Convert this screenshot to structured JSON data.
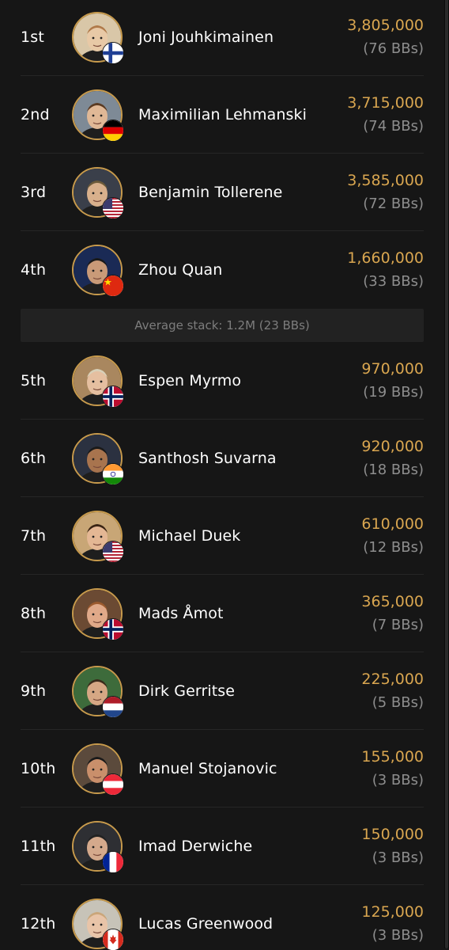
{
  "players": [
    {
      "rank": "1st",
      "name": "Joni Jouhkimainen",
      "chips": "3,805,000",
      "bbs": "(76 BBs)",
      "flag": "finland-flag-icon"
    },
    {
      "rank": "2nd",
      "name": "Maximilian Lehmanski",
      "chips": "3,715,000",
      "bbs": "(74 BBs)",
      "flag": "germany-flag-icon"
    },
    {
      "rank": "3rd",
      "name": "Benjamin Tollerene",
      "chips": "3,585,000",
      "bbs": "(72 BBs)",
      "flag": "usa-flag-icon"
    },
    {
      "rank": "4th",
      "name": "Zhou Quan",
      "chips": "1,660,000",
      "bbs": "(33 BBs)",
      "flag": "china-flag-icon"
    },
    {
      "rank": "5th",
      "name": "Espen Myrmo",
      "chips": "970,000",
      "bbs": "(19 BBs)",
      "flag": "norway-flag-icon"
    },
    {
      "rank": "6th",
      "name": "Santhosh Suvarna",
      "chips": "920,000",
      "bbs": "(18 BBs)",
      "flag": "india-flag-icon"
    },
    {
      "rank": "7th",
      "name": "Michael Duek",
      "chips": "610,000",
      "bbs": "(12 BBs)",
      "flag": "usa-flag-icon"
    },
    {
      "rank": "8th",
      "name": "Mads Åmot",
      "chips": "365,000",
      "bbs": "(7 BBs)",
      "flag": "norway-flag-icon"
    },
    {
      "rank": "9th",
      "name": "Dirk Gerritse",
      "chips": "225,000",
      "bbs": "(5 BBs)",
      "flag": "netherlands-flag-icon"
    },
    {
      "rank": "10th",
      "name": "Manuel Stojanovic",
      "chips": "155,000",
      "bbs": "(3 BBs)",
      "flag": "austria-flag-icon"
    },
    {
      "rank": "11th",
      "name": "Imad Derwiche",
      "chips": "150,000",
      "bbs": "(3 BBs)",
      "flag": "france-flag-icon"
    },
    {
      "rank": "12th",
      "name": "Lucas Greenwood",
      "chips": "125,000",
      "bbs": "(3 BBs)",
      "flag": "canada-flag-icon"
    }
  ],
  "average_stack": "Average stack: 1.2M (23 BBs)",
  "colors": {
    "chips": "#d9a650",
    "avatar_ring": "#c79a4c",
    "background": "#161616"
  }
}
